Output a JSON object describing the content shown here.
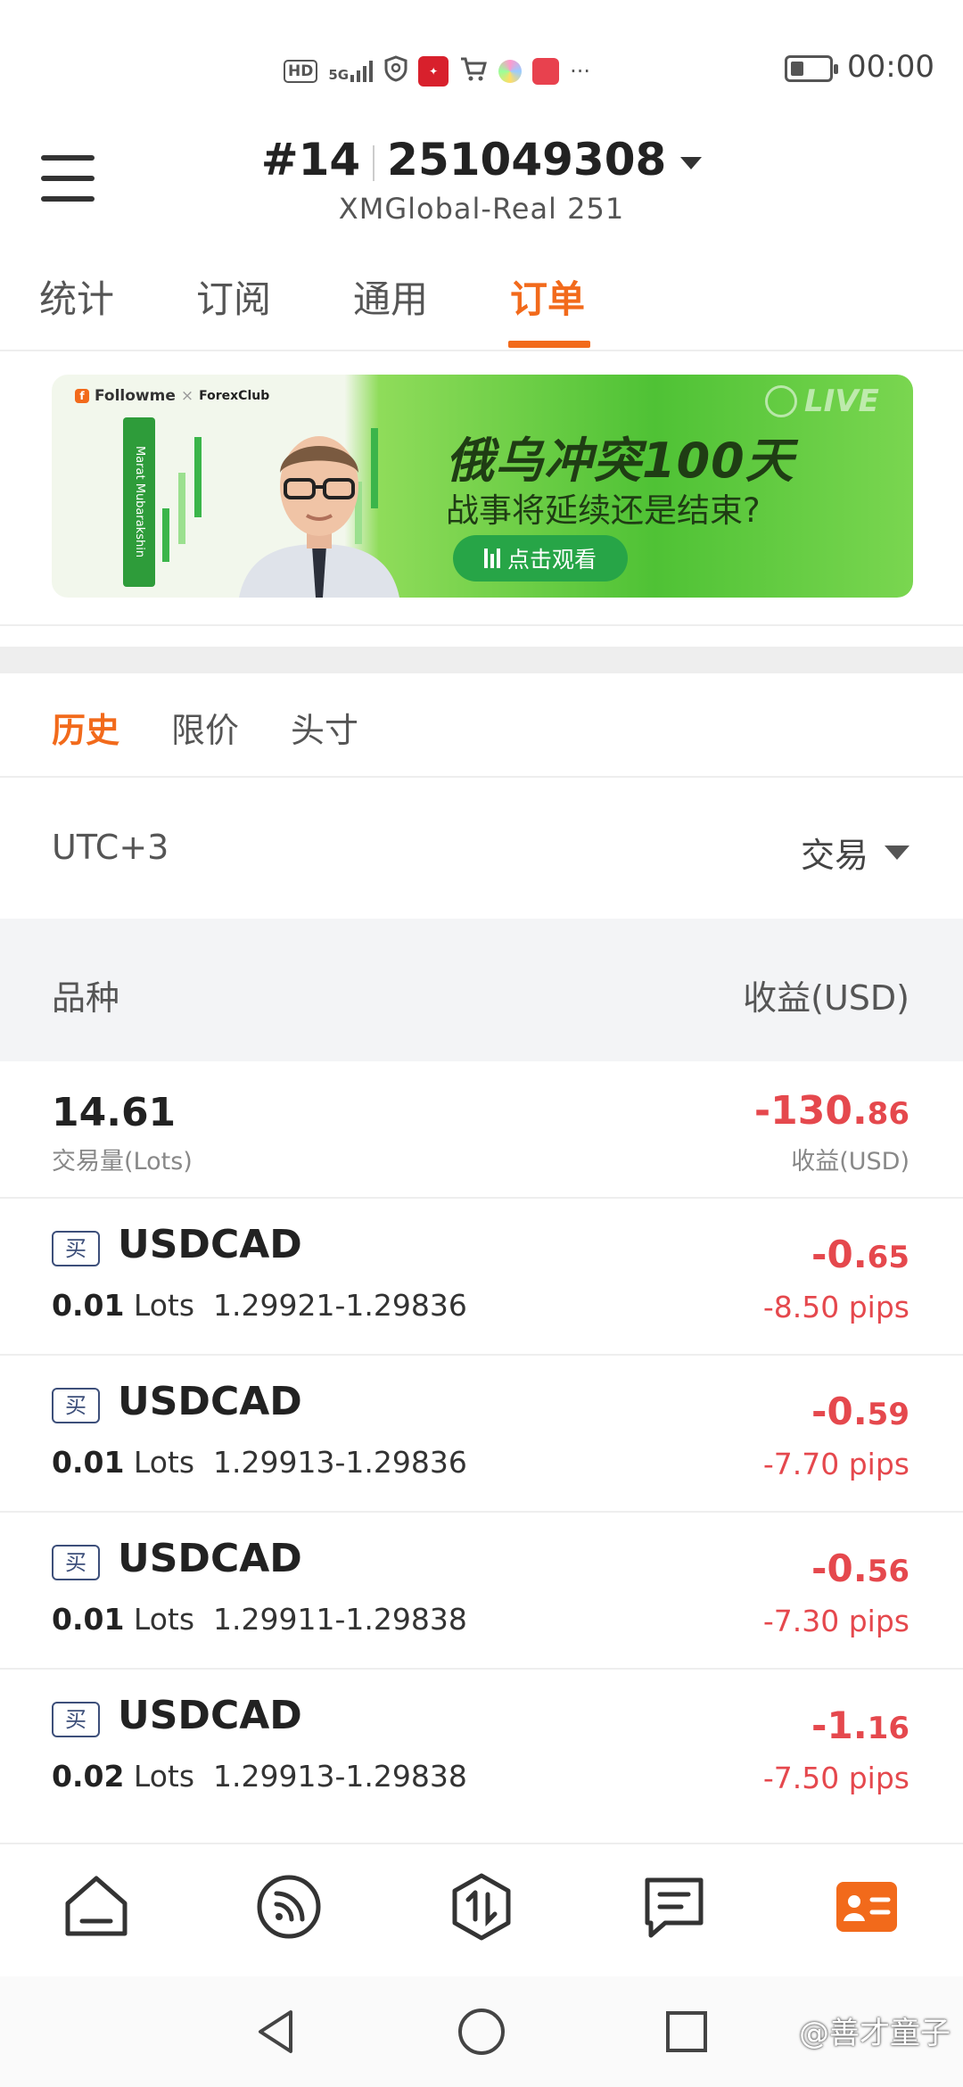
{
  "status_bar": {
    "left_icons": [
      "hd-icon",
      "signal-5g-icon",
      "vpn-shield-icon",
      "app-red-icon",
      "cart-icon",
      "color-dot-icon",
      "book-icon",
      "more-dots-icon"
    ],
    "hd": "HD",
    "net": "5G",
    "more": "···",
    "time": "00:00"
  },
  "header": {
    "account_prefix": "#14",
    "account_number": "251049308",
    "server": "XMGlobal-Real 251"
  },
  "tabs": [
    {
      "label": "统计",
      "active": false
    },
    {
      "label": "订阅",
      "active": false
    },
    {
      "label": "通用",
      "active": false
    },
    {
      "label": "订单",
      "active": true
    }
  ],
  "banner": {
    "brand": "Followme",
    "partner": "ForexClub",
    "name_vertical": "Marat Mubarakshin",
    "title": "俄乌冲突100天",
    "subtitle": "战事将延续还是结束?",
    "button": "点击观看",
    "live": "LIVE"
  },
  "sub_tabs": [
    {
      "label": "历史",
      "active": true
    },
    {
      "label": "限价",
      "active": false
    },
    {
      "label": "头寸",
      "active": false
    }
  ],
  "filter": {
    "timezone": "UTC+3",
    "type": "交易"
  },
  "table_header": {
    "left": "品种",
    "right": "收益(USD)"
  },
  "summary": {
    "volume": "14.61",
    "volume_label": "交易量(Lots)",
    "profit_main": "-130.",
    "profit_decimal": "86",
    "profit_label": "收益(USD)"
  },
  "trades": [
    {
      "side": "买",
      "symbol": "USDCAD",
      "lots": "0.01",
      "lots_unit": "Lots",
      "prices": "1.29921-1.29836",
      "profit_main": "-0.",
      "profit_decimal": "65",
      "pips": "-8.50 pips"
    },
    {
      "side": "买",
      "symbol": "USDCAD",
      "lots": "0.01",
      "lots_unit": "Lots",
      "prices": "1.29913-1.29836",
      "profit_main": "-0.",
      "profit_decimal": "59",
      "pips": "-7.70 pips"
    },
    {
      "side": "买",
      "symbol": "USDCAD",
      "lots": "0.01",
      "lots_unit": "Lots",
      "prices": "1.29911-1.29838",
      "profit_main": "-0.",
      "profit_decimal": "56",
      "pips": "-7.30 pips"
    },
    {
      "side": "买",
      "symbol": "USDCAD",
      "lots": "0.02",
      "lots_unit": "Lots",
      "prices": "1.29913-1.29838",
      "profit_main": "-1.",
      "profit_decimal": "16",
      "pips": "-7.50 pips"
    }
  ],
  "bottom_nav": [
    "home-icon",
    "feed-icon",
    "trade-icon",
    "notes-icon",
    "profile-card-icon"
  ],
  "system_nav": [
    "back-icon",
    "home-circle-icon",
    "recents-icon"
  ],
  "watermark": "@善才童子",
  "colors": {
    "accent": "#f26a1b",
    "loss": "#e5484d",
    "badge": "#3d4f7a"
  }
}
